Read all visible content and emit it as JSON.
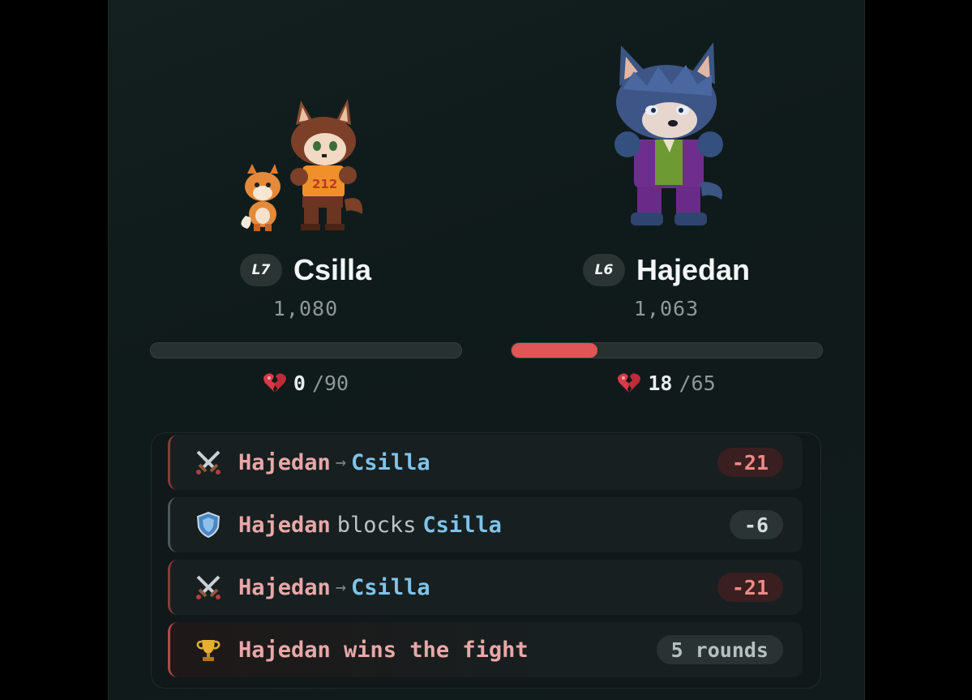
{
  "fighters": [
    {
      "level": "L7",
      "name": "Csilla",
      "score": "1,080",
      "hp_current": "0",
      "hp_max": "/90",
      "hp_fraction": 0.0,
      "sprite": "wolf-boy-with-fox"
    },
    {
      "level": "L6",
      "name": "Hajedan",
      "score": "1,063",
      "hp_current": "18",
      "hp_max": "/65",
      "hp_fraction": 0.277,
      "sprite": "blue-wolf-purple-suit"
    }
  ],
  "log": [
    {
      "type": "attack",
      "icon": "crossed-swords-icon",
      "actor": "Hajedan",
      "arrow": "→",
      "target": "Csilla",
      "badge": "-21"
    },
    {
      "type": "block",
      "icon": "shield-icon",
      "actor": "Hajedan",
      "verb": "blocks",
      "target": "Csilla",
      "badge": "-6"
    },
    {
      "type": "attack",
      "icon": "crossed-swords-icon",
      "actor": "Hajedan",
      "arrow": "→",
      "target": "Csilla",
      "badge": "-21"
    },
    {
      "type": "win",
      "icon": "trophy-icon",
      "text": "Hajedan wins the fight",
      "badge": "5 rounds"
    }
  ],
  "colors": {
    "hp_fill": "#e05656",
    "actor": "#e9a7a7",
    "target": "#7fc3ea",
    "damage_badge": "#f08a86"
  }
}
